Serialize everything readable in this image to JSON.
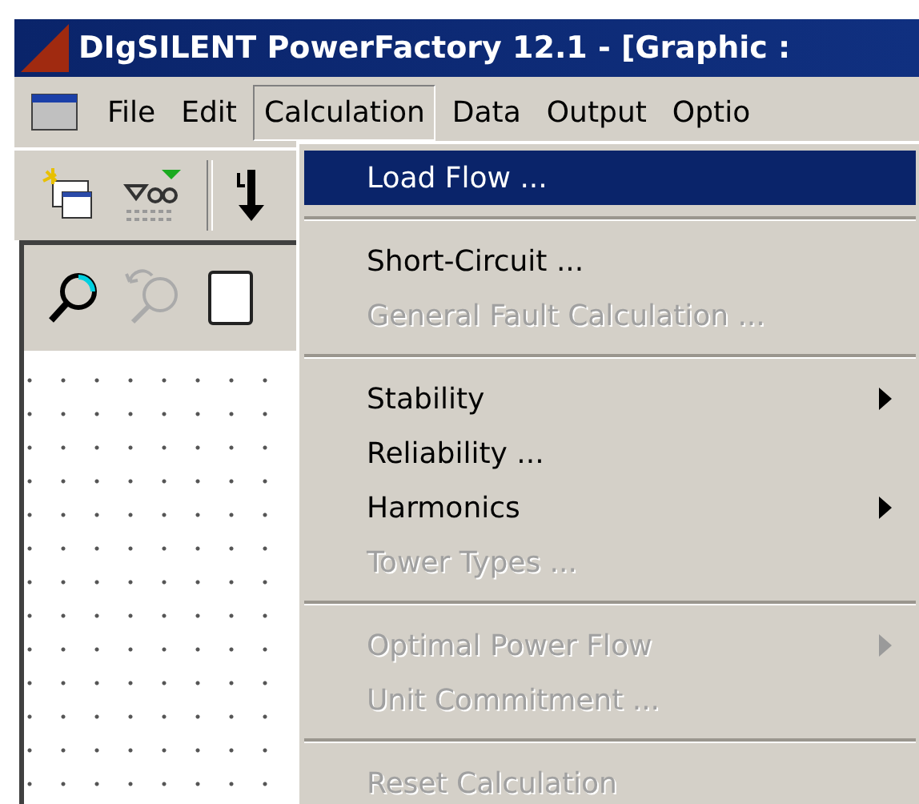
{
  "window": {
    "title": "DIgSILENT PowerFactory 12.1 - [Graphic :"
  },
  "menu_bar": [
    {
      "label": "File",
      "selected": false
    },
    {
      "label": "Edit",
      "selected": false
    },
    {
      "label": "Calculation",
      "selected": true
    },
    {
      "label": "Data",
      "selected": false
    },
    {
      "label": "Output",
      "selected": false
    },
    {
      "label": "Optio",
      "selected": false
    }
  ],
  "dropdown": [
    {
      "kind": "item",
      "label": "Load Flow ...",
      "selected": true,
      "disabled": false,
      "submenu": false
    },
    {
      "kind": "separator"
    },
    {
      "kind": "item",
      "label": "Short-Circuit ...",
      "selected": false,
      "disabled": false,
      "submenu": false
    },
    {
      "kind": "item",
      "label": "General Fault Calculation ...",
      "selected": false,
      "disabled": true,
      "submenu": false
    },
    {
      "kind": "separator"
    },
    {
      "kind": "item",
      "label": "Stability",
      "selected": false,
      "disabled": false,
      "submenu": true
    },
    {
      "kind": "item",
      "label": "Reliability ...",
      "selected": false,
      "disabled": false,
      "submenu": false
    },
    {
      "kind": "item",
      "label": "Harmonics",
      "selected": false,
      "disabled": false,
      "submenu": true
    },
    {
      "kind": "item",
      "label": "Tower Types ...",
      "selected": false,
      "disabled": true,
      "submenu": false
    },
    {
      "kind": "separator"
    },
    {
      "kind": "item",
      "label": "Optimal Power Flow",
      "selected": false,
      "disabled": true,
      "submenu": true
    },
    {
      "kind": "item",
      "label": "Unit Commitment ...",
      "selected": false,
      "disabled": true,
      "submenu": false
    },
    {
      "kind": "separator"
    },
    {
      "kind": "item",
      "label": "Reset Calculation",
      "selected": false,
      "disabled": true,
      "submenu": false
    }
  ]
}
